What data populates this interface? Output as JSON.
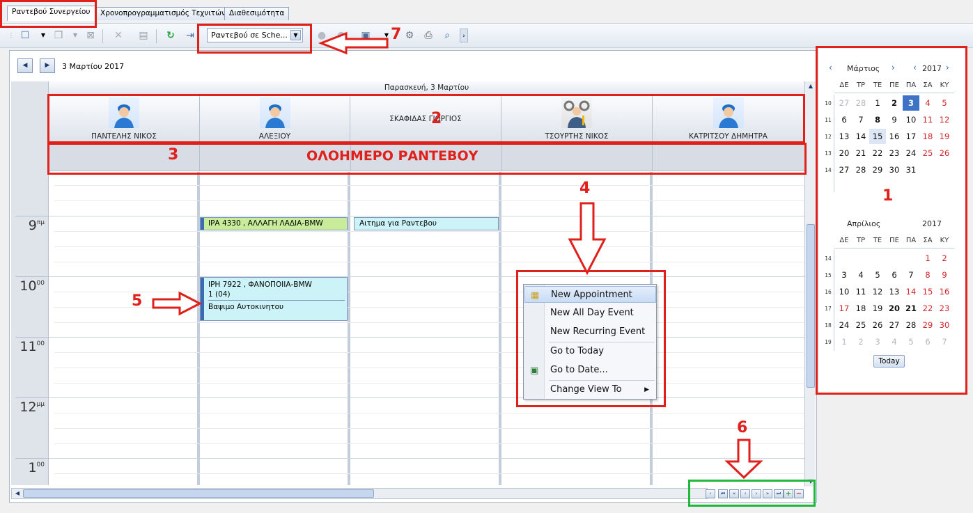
{
  "tabs": [
    {
      "label": "Ραντεβού Συνεργείου"
    },
    {
      "label": "Χρονοπρογραμματισμός Τεχνιτών"
    },
    {
      "label": "Διαθεσιμότητα"
    }
  ],
  "toolbar": {
    "view_select": "Ραντεβού σε Sche..."
  },
  "nav": {
    "date": "3 Μαρτίου 2017"
  },
  "day_header": "Παρασκευή, 3 Μαρτίου",
  "resources": [
    {
      "name": "ΠΑΝΤΕΛΗΣ ΝΙΚΟΣ"
    },
    {
      "name": "ΑΛΕΞΙΟΥ"
    },
    {
      "name": "ΣΚΑΦΙΔΑΣ ΓΙΩΡΓΙΟΣ"
    },
    {
      "name": "ΤΣΟΥΡΤΗΣ ΝΙΚΟΣ"
    },
    {
      "name": "ΚΑΤΡΙΤΣΟΥ ΔΗΜΗΤΡΑ"
    }
  ],
  "allday_label": "ΟΛΟΗΜΕΡΟ ΡΑΝΤΕΒΟΥ",
  "hours": [
    {
      "h": "9",
      "m": "πμ"
    },
    {
      "h": "10",
      "m": "00"
    },
    {
      "h": "11",
      "m": "00"
    },
    {
      "h": "12",
      "m": "μμ"
    },
    {
      "h": "1",
      "m": "00"
    }
  ],
  "appointments": [
    {
      "title": "ΙΡΑ 4330 , ΑΛΛΑΓΗ ΛΑΔΙΑ-BMW",
      "color": "#c8ec9a"
    },
    {
      "title": "Αιτημα για Ραντεβου",
      "color": "#ccf4f8"
    },
    {
      "title": "ΙΡΗ 7922 , ΦΑΝΟΠΟΙΙΑ-BMW",
      "line2": "1 (04)",
      "line3": "Βαψιμο Αυτοκινητου",
      "color": "#ccf4f8"
    }
  ],
  "context_menu": [
    {
      "label": "New Appointment",
      "icon": "new-appointment-icon"
    },
    {
      "label": "New All Day Event"
    },
    {
      "label": "New Recurring Event"
    },
    {
      "label": "Go to Today"
    },
    {
      "label": "Go to Date...",
      "icon": "calendar-goto-icon"
    },
    {
      "label": "Change View To"
    }
  ],
  "calendar": {
    "march": {
      "month": "Μάρτιος",
      "year": "2017"
    },
    "april": {
      "month": "Απρίλιος",
      "year": "2017"
    },
    "dow": [
      "ΔΕ",
      "ΤΡ",
      "ΤΕ",
      "ΠΕ",
      "ΠΑ",
      "ΣΑ",
      "ΚΥ"
    ],
    "march_weeks": [
      "10",
      "11",
      "12",
      "13",
      "14"
    ],
    "april_weeks": [
      "14",
      "15",
      "16",
      "17",
      "18",
      "19"
    ],
    "today_label": "Today"
  },
  "annotations": {
    "n1": "1",
    "n2": "2",
    "n3": "3",
    "n4": "4",
    "n5": "5",
    "n6": "6",
    "n7": "7"
  },
  "colors": {
    "accent": "#3d72c6",
    "annotation_red": "#e0201a",
    "annotation_green": "#1fb83a"
  }
}
